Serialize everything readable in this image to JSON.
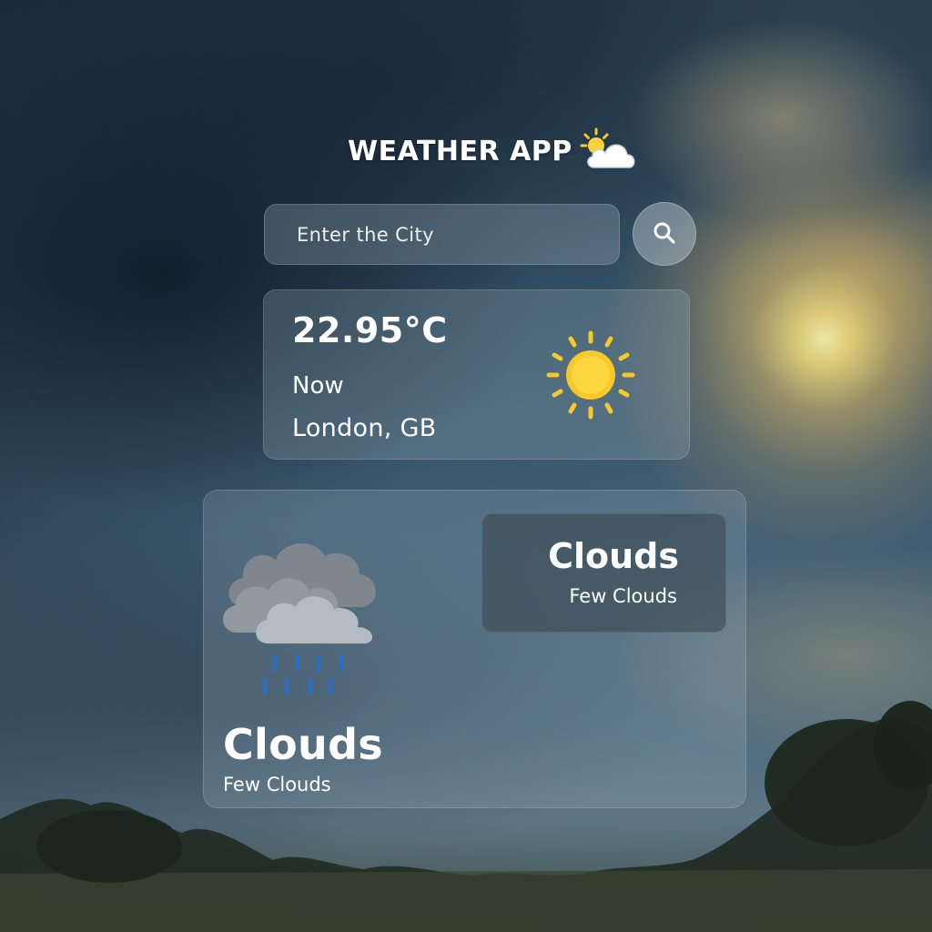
{
  "app": {
    "title": "WEATHER APP",
    "title_icon": "sun-behind-cloud-icon"
  },
  "search": {
    "placeholder": "Enter the City",
    "value": "",
    "button_icon": "search-icon"
  },
  "current": {
    "temperature": "22.95°C",
    "time_label": "Now",
    "location": "London, GB",
    "icon": "sun-icon"
  },
  "forecast": {
    "icon": "rain-cloud-icon",
    "condition": "Clouds",
    "description": "Few Clouds",
    "summary_card": {
      "condition": "Clouds",
      "description": "Few Clouds"
    }
  },
  "colors": {
    "sun_yellow": "#f6c92a",
    "sun_core": "#f9d23c",
    "cloud_gray": "#aeb5bd",
    "rain_blue": "#2f6fba",
    "text": "#ffffff"
  }
}
